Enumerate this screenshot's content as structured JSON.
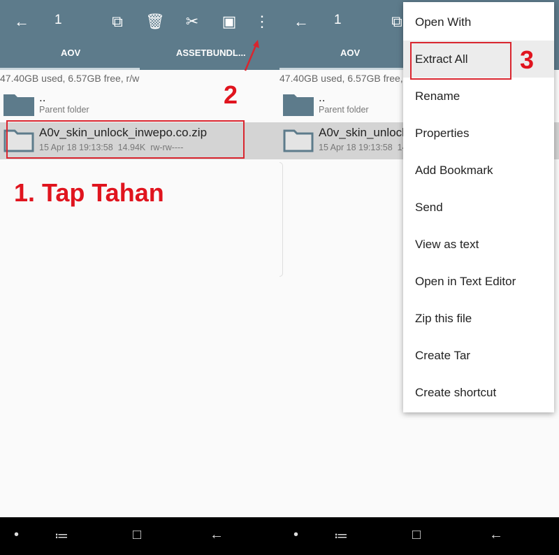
{
  "toolbar": {
    "count": "1",
    "icons": [
      "back-arrow-icon",
      "copy-icon",
      "delete-icon",
      "cut-icon",
      "select-all-icon",
      "more-vert-icon"
    ]
  },
  "tabs": [
    "AOV",
    "ASSETBUNDL..."
  ],
  "storage": "47.40GB used, 6.57GB free, r/w",
  "files": [
    {
      "name": "..",
      "sub": "Parent folder"
    },
    {
      "name": "A0v_skin_unlock_inwepo.co.zip",
      "date": "15 Apr 18 19:13:58",
      "size": "14.94K",
      "perm": "rw-rw----"
    }
  ],
  "menu": [
    "Open With",
    "Extract All",
    "Rename",
    "Properties",
    "Add Bookmark",
    "Send",
    "View as text",
    "Open in Text Editor",
    "Zip this file",
    "Create Tar",
    "Create shortcut"
  ],
  "annotations": {
    "step1": "1. Tap Tahan",
    "step2": "2",
    "step3": "3"
  },
  "colors": {
    "header": "#5d7b8b",
    "annotation": "#e0141e",
    "selected_row": "#d4d4d4"
  }
}
